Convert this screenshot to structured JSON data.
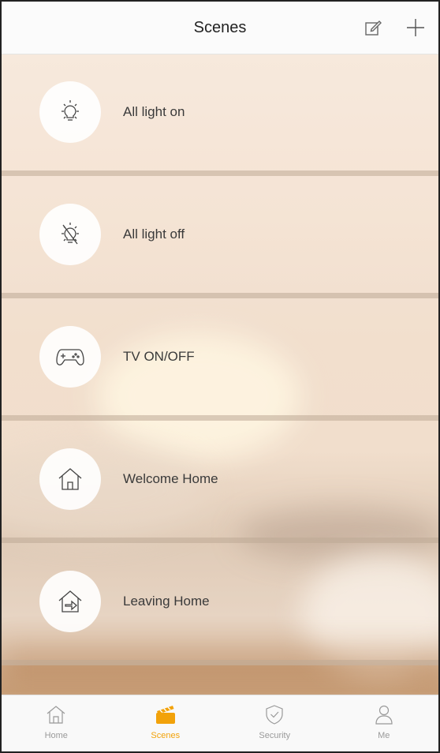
{
  "header": {
    "title": "Scenes",
    "edit_icon": "edit-icon",
    "add_icon": "plus-icon"
  },
  "scenes": [
    {
      "label": "All light on",
      "icon": "lightbulb-on-icon"
    },
    {
      "label": "All light off",
      "icon": "lightbulb-off-icon"
    },
    {
      "label": "TV ON/OFF",
      "icon": "gamepad-icon"
    },
    {
      "label": "Welcome Home",
      "icon": "home-icon"
    },
    {
      "label": "Leaving Home",
      "icon": "leave-home-icon"
    }
  ],
  "tabbar": {
    "items": [
      {
        "label": "Home",
        "icon": "home-icon"
      },
      {
        "label": "Scenes",
        "icon": "clapperboard-icon",
        "active": true
      },
      {
        "label": "Security",
        "icon": "shield-icon"
      },
      {
        "label": "Me",
        "icon": "person-icon"
      }
    ]
  },
  "colors": {
    "accent": "#f2a20a",
    "text": "#3a3a3a",
    "inactive": "#9a9a9a"
  }
}
